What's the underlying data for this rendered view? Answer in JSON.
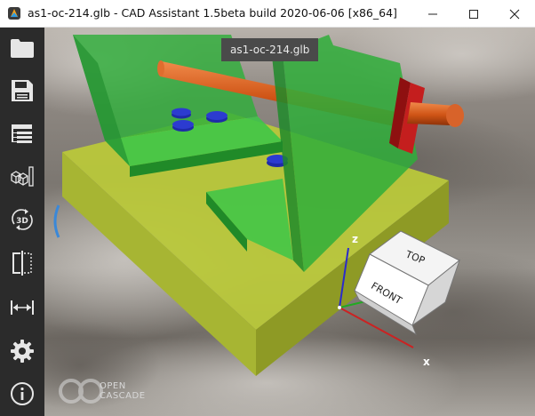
{
  "window": {
    "title": "as1-oc-214.glb - CAD Assistant 1.5beta build 2020-06-06 [x86_64]",
    "controls": [
      "minimize",
      "maximize",
      "close"
    ]
  },
  "sidebar": {
    "items": [
      {
        "id": "open",
        "icon": "folder-icon"
      },
      {
        "id": "save",
        "icon": "floppy-disk-icon"
      },
      {
        "id": "structure",
        "icon": "model-tree-icon"
      },
      {
        "id": "explode",
        "icon": "cubes-icon"
      },
      {
        "id": "view-3d",
        "icon": "rotate-3d-icon",
        "label": "3D"
      },
      {
        "id": "clipping",
        "icon": "section-plane-icon"
      },
      {
        "id": "measure",
        "icon": "measure-icon"
      },
      {
        "id": "settings",
        "icon": "gear-icon"
      },
      {
        "id": "about",
        "icon": "info-icon"
      }
    ]
  },
  "viewport": {
    "document_tab": "as1-oc-214.glb",
    "axes": {
      "z": "z",
      "x": "x"
    },
    "view_cube": {
      "top": "TOP",
      "front": "FRONT"
    },
    "watermark": {
      "line1": "OPEN",
      "line2": "CASCADE"
    }
  },
  "colors": {
    "sidebar": "#2b2b2b",
    "base_plate": "#b9c83a",
    "green_panel": "#2fae3a",
    "red_block": "#c41e1e",
    "rod": "#d0581c",
    "discs": "#1e2ba8"
  }
}
